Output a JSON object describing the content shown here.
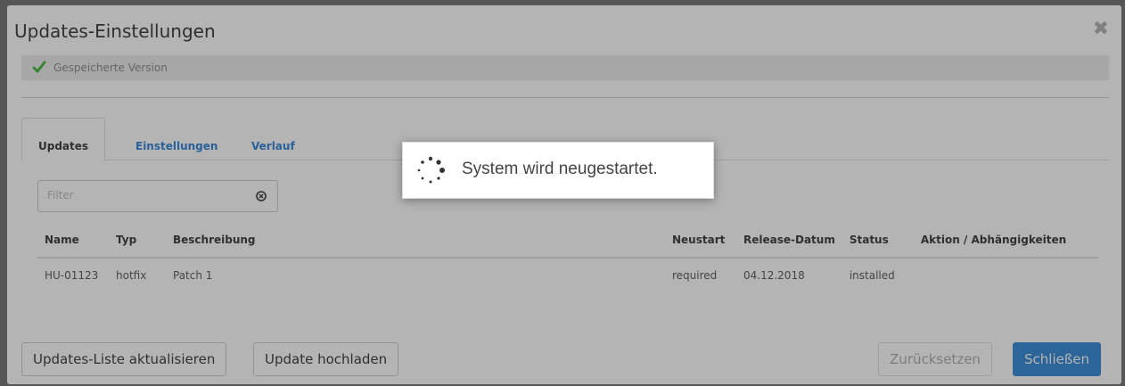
{
  "dialog": {
    "title": "Updates-Einstellungen",
    "close_icon": "close-icon",
    "saved_status": "Gespeicherte Version"
  },
  "tabs": [
    {
      "label": "Updates",
      "active": true
    },
    {
      "label": "Einstellungen",
      "active": false
    },
    {
      "label": "Verlauf",
      "active": false
    }
  ],
  "filter": {
    "placeholder": "Filter",
    "value": ""
  },
  "table": {
    "headers": [
      "Name",
      "Typ",
      "Beschreibung",
      "Neustart",
      "Release-Datum",
      "Status",
      "Aktion / Abhängigkeiten"
    ],
    "rows": [
      [
        "HU-01123",
        "hotfix",
        "Patch 1",
        "required",
        "04.12.2018",
        "installed",
        ""
      ]
    ]
  },
  "buttons": {
    "refresh_list": "Updates-Liste aktualisieren",
    "upload_update": "Update hochladen",
    "reset": "Zurücksetzen",
    "close": "Schließen"
  },
  "overlay": {
    "message": "System wird neugestartet."
  },
  "colors": {
    "accent": "#2e86d6",
    "success": "#3bb53b"
  }
}
